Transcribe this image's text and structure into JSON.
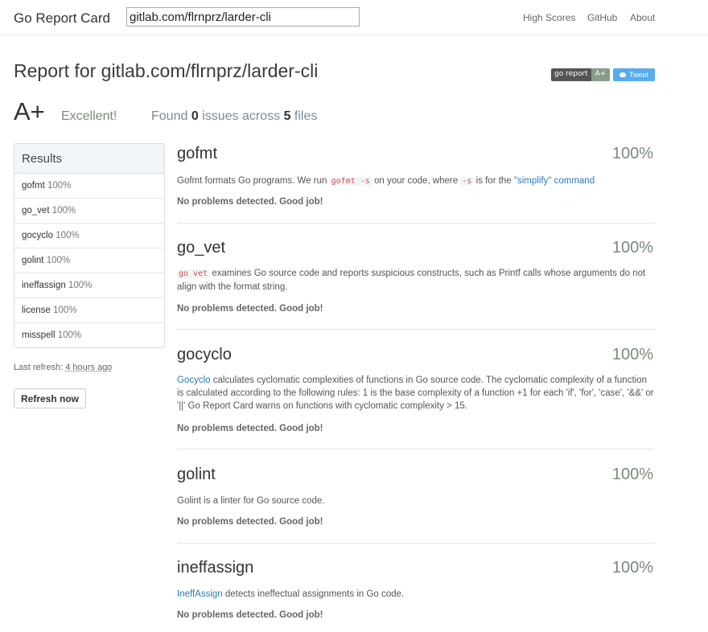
{
  "header": {
    "brand": "Go Report Card",
    "search_value": "gitlab.com/flrnprz/larder-cli",
    "nav": [
      "High Scores",
      "GitHub",
      "About"
    ]
  },
  "report": {
    "title": "Report for gitlab.com/flrnprz/larder-cli",
    "badge_left": "go report",
    "badge_right": "A+",
    "tweet_label": "Tweet",
    "grade": "A+",
    "grade_text": "Excellent!",
    "found_prefix": "Found",
    "issues": "0",
    "found_middle": "issues across",
    "files": "5",
    "found_suffix": "files"
  },
  "sidebar": {
    "results_title": "Results",
    "items": [
      {
        "name": "gofmt",
        "pct": "100%"
      },
      {
        "name": "go_vet",
        "pct": "100%"
      },
      {
        "name": "gocyclo",
        "pct": "100%"
      },
      {
        "name": "golint",
        "pct": "100%"
      },
      {
        "name": "ineffassign",
        "pct": "100%"
      },
      {
        "name": "license",
        "pct": "100%"
      },
      {
        "name": "misspell",
        "pct": "100%"
      }
    ],
    "last_refresh_label": "Last refresh:",
    "last_refresh_value": "4 hours ago",
    "refresh_button": "Refresh now"
  },
  "checks": {
    "gofmt": {
      "name": "gofmt",
      "score": "100%",
      "d1": "Gofmt formats Go programs. We run ",
      "code1": "gofmt -s",
      "d2": " on your code, where ",
      "code2": "-s",
      "d3": " is for the ",
      "link1": "\"simplify\" command",
      "ok": "No problems detected. Good job!"
    },
    "go_vet": {
      "name": "go_vet",
      "score": "100%",
      "code1": "go vet",
      "d1": " examines Go source code and reports suspicious constructs, such as Printf calls whose arguments do not align with the format string.",
      "ok": "No problems detected. Good job!"
    },
    "gocyclo": {
      "name": "gocyclo",
      "score": "100%",
      "link1": "Gocyclo",
      "d1": " calculates cyclomatic complexities of functions in Go source code. The cyclomatic complexity of a function is calculated according to the following rules: 1 is the base complexity of a function +1 for each 'if', 'for', 'case', '&&' or '||' Go Report Card warns on functions with cyclomatic complexity > 15.",
      "ok": "No problems detected. Good job!"
    },
    "golint": {
      "name": "golint",
      "score": "100%",
      "d1": "Golint is a linter for Go source code.",
      "ok": "No problems detected. Good job!"
    },
    "ineffassign": {
      "name": "ineffassign",
      "score": "100%",
      "link1": "IneffAssign",
      "d1": " detects ineffectual assignments in Go code.",
      "ok": "No problems detected. Good job!"
    }
  }
}
